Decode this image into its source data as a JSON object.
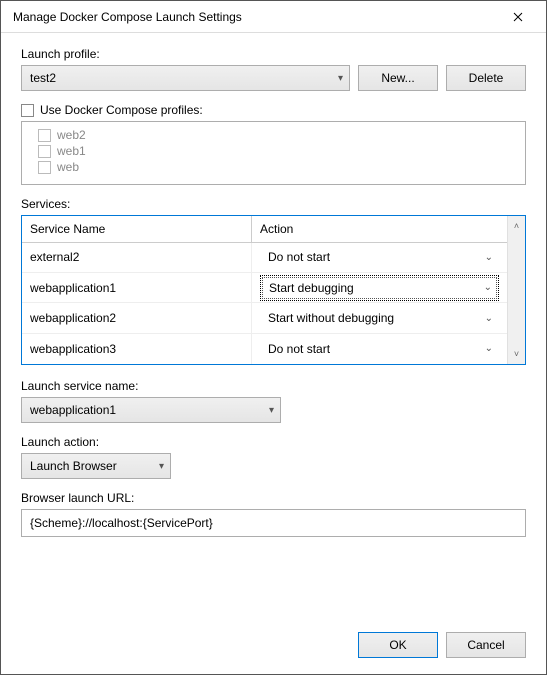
{
  "titlebar": {
    "title": "Manage Docker Compose Launch Settings"
  },
  "launch_profile": {
    "label": "Launch profile:",
    "value": "test2",
    "buttons": {
      "new": "New...",
      "delete": "Delete"
    }
  },
  "use_profiles": {
    "label": "Use Docker Compose profiles:",
    "checked": false,
    "items": [
      {
        "label": "web2",
        "checked": false
      },
      {
        "label": "web1",
        "checked": false
      },
      {
        "label": "web",
        "checked": false
      }
    ]
  },
  "services": {
    "label": "Services:",
    "columns": {
      "name": "Service Name",
      "action": "Action"
    },
    "rows": [
      {
        "name": "external2",
        "action": "Do not start",
        "highlighted": false
      },
      {
        "name": "webapplication1",
        "action": "Start debugging",
        "highlighted": true
      },
      {
        "name": "webapplication2",
        "action": "Start without debugging",
        "highlighted": false
      },
      {
        "name": "webapplication3",
        "action": "Do not start",
        "highlighted": false
      }
    ]
  },
  "launch_service": {
    "label": "Launch service name:",
    "value": "webapplication1"
  },
  "launch_action": {
    "label": "Launch action:",
    "value": "Launch Browser"
  },
  "browser_url": {
    "label": "Browser launch URL:",
    "value": "{Scheme}://localhost:{ServicePort}"
  },
  "footer": {
    "ok": "OK",
    "cancel": "Cancel"
  }
}
